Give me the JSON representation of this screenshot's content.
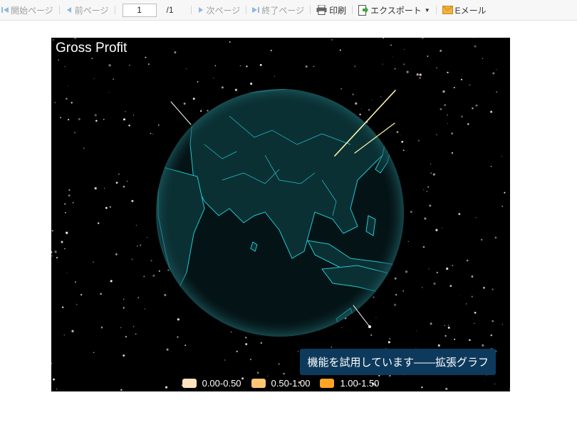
{
  "toolbar": {
    "first_page": "開始ページ",
    "prev_page": "前ページ",
    "page_number": "1",
    "page_total": "/1",
    "next_page": "次ページ",
    "last_page": "終了ページ",
    "print": "印刷",
    "export": "エクスポート",
    "email": "Eメール"
  },
  "chart": {
    "title": "Gross Profit",
    "trial_banner": "機能を試用しています——拡張グラフ",
    "legend": [
      {
        "label": "0.00-0.50",
        "color": "#ffe2bd"
      },
      {
        "label": "0.50-1.00",
        "color": "#ffc673"
      },
      {
        "label": "1.00-1.50",
        "color": "#ffa526"
      }
    ]
  },
  "chart_data": {
    "type": "map",
    "title": "Gross Profit",
    "legend_position": "bottom",
    "ranges": [
      "0.00-0.50",
      "0.50-1.00",
      "1.00-1.50"
    ]
  },
  "colors": {
    "ocean": "#041416",
    "land": "#0b3034",
    "border": "#22c7cf",
    "background": "#000000"
  }
}
